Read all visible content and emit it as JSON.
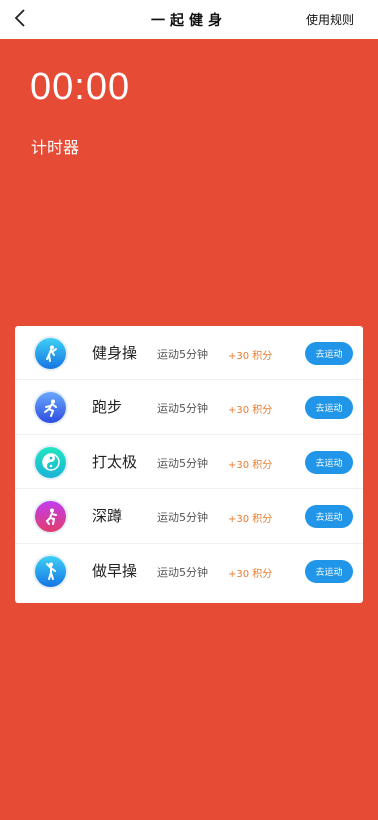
{
  "nav": {
    "title": "一起健身",
    "rules_label": "使用规则"
  },
  "timer": {
    "value": "00:00",
    "label": "计时器"
  },
  "activities": [
    {
      "name": "健身操",
      "desc": "运动5分钟",
      "points": "+30 积分",
      "button": "去运动",
      "icon": "aerobics-icon",
      "color_a": "#3fd0f5",
      "color_b": "#1575e3"
    },
    {
      "name": "跑步",
      "desc": "运动5分钟",
      "points": "+30 积分",
      "button": "去运动",
      "icon": "running-icon",
      "color_a": "#6aa8ff",
      "color_b": "#2d4de0"
    },
    {
      "name": "打太极",
      "desc": "运动5分钟",
      "points": "+30 积分",
      "button": "去运动",
      "icon": "taichi-icon",
      "color_a": "#22e6c0",
      "color_b": "#1ab3d6"
    },
    {
      "name": "深蹲",
      "desc": "运动5分钟",
      "points": "+30 积分",
      "button": "去运动",
      "icon": "squat-icon",
      "color_a": "#c13cf0",
      "color_b": "#e23d6c"
    },
    {
      "name": "做早操",
      "desc": "运动5分钟",
      "points": "+30 积分",
      "button": "去运动",
      "icon": "morning-exercise-icon",
      "color_a": "#3fd0f5",
      "color_b": "#1575e3"
    }
  ],
  "colors": {
    "background": "#e64b35",
    "button": "#2196e8",
    "points": "#ec7a2c"
  }
}
